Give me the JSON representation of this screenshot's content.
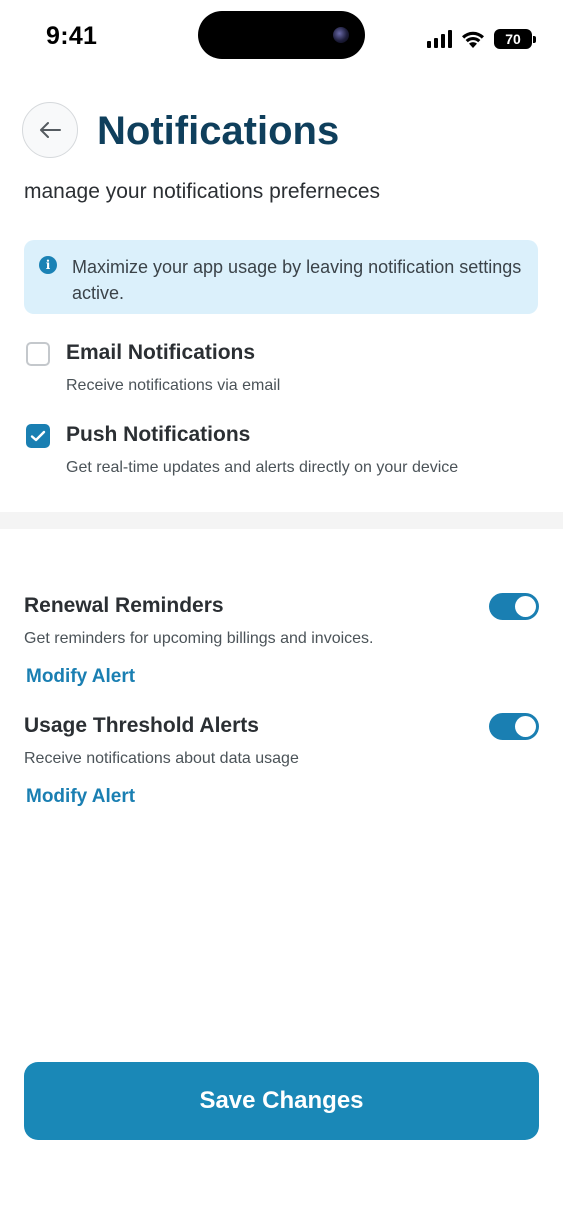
{
  "status_bar": {
    "time": "9:41",
    "battery_level": "70",
    "icons": [
      "signal-icon",
      "wifi-icon",
      "battery-icon"
    ]
  },
  "header": {
    "back_icon": "arrow-left-icon",
    "title": "Notifications",
    "subtitle": "manage your notifications preferneces"
  },
  "info_banner": {
    "icon": "info-icon",
    "text": "Maximize your app usage by leaving notification settings active."
  },
  "channels": [
    {
      "title": "Email Notifications",
      "description": "Receive notifications via email",
      "checked": false
    },
    {
      "title": "Push Notifications",
      "description": "Get real-time updates and alerts directly on your device",
      "checked": true
    }
  ],
  "alerts": [
    {
      "title": "Renewal Reminders",
      "description": "Get reminders for upcoming billings and invoices.",
      "enabled": true,
      "link_label": "Modify Alert"
    },
    {
      "title": "Usage Threshold Alerts",
      "description": "Receive notifications about data usage",
      "enabled": true,
      "link_label": "Modify Alert"
    }
  ],
  "footer": {
    "save_label": "Save Changes"
  },
  "colors": {
    "accent": "#1a7fb2",
    "title": "#0f3f5c",
    "banner_bg": "#dbf0fb",
    "save_button": "#1a88b7"
  }
}
